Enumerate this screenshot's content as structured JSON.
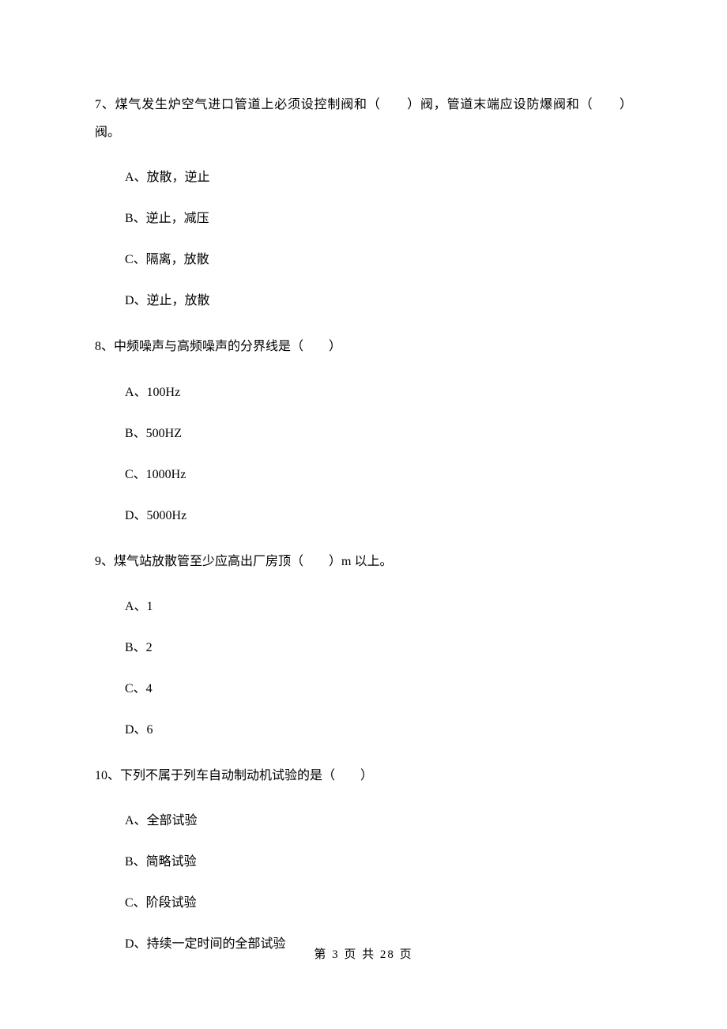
{
  "questions": [
    {
      "number": "7、",
      "stem_parts": [
        "煤气发生炉空气进口管道上必须设控制阀和（　　）阀，管道末端应设防爆阀和（　　）阀。"
      ],
      "options": [
        "A、放散，逆止",
        "B、逆止，减压",
        "C、隔离，放散",
        "D、逆止，放散"
      ]
    },
    {
      "number": "8、",
      "stem_parts": [
        "中频噪声与高频噪声的分界线是（　　）"
      ],
      "options": [
        "A、100Hz",
        "B、500HZ",
        "C、1000Hz",
        "D、5000Hz"
      ]
    },
    {
      "number": "9、",
      "stem_parts": [
        "煤气站放散管至少应高出厂房顶（　　）m 以上。"
      ],
      "options": [
        "A、1",
        "B、2",
        "C、4",
        "D、6"
      ]
    },
    {
      "number": "10、",
      "stem_parts": [
        "下列不属于列车自动制动机试验的是（　　）"
      ],
      "options": [
        "A、全部试验",
        "B、简略试验",
        "C、阶段试验",
        "D、持续一定时间的全部试验"
      ]
    }
  ],
  "footer": "第 3 页 共 28 页"
}
